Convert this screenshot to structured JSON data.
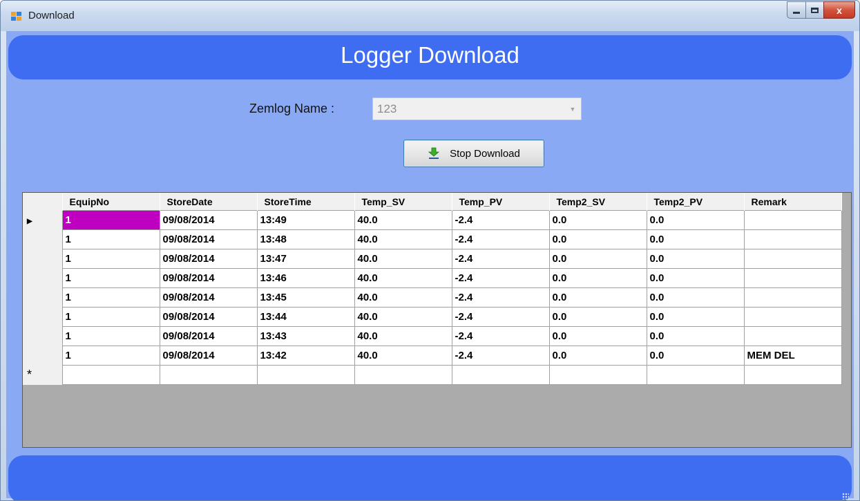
{
  "window": {
    "title": "Download",
    "icon": "windows-form-icon",
    "caption_buttons": [
      "minimize",
      "maximize",
      "close"
    ],
    "close_glyph": "x"
  },
  "header": {
    "title": "Logger Download",
    "banner_color": "#3e6df1"
  },
  "form": {
    "zemlog_label": "Zemlog Name :",
    "zemlog_value": "123",
    "stop_button_label": "Stop Download",
    "stop_button_icon": "download-arrow-icon"
  },
  "grid": {
    "columns": [
      "EquipNo",
      "StoreDate",
      "StoreTime",
      "Temp_SV",
      "Temp_PV",
      "Temp2_SV",
      "Temp2_PV",
      "Remark"
    ],
    "rows": [
      [
        "1",
        "09/08/2014",
        "13:49",
        "40.0",
        "-2.4",
        "0.0",
        "0.0",
        ""
      ],
      [
        "1",
        "09/08/2014",
        "13:48",
        "40.0",
        "-2.4",
        "0.0",
        "0.0",
        ""
      ],
      [
        "1",
        "09/08/2014",
        "13:47",
        "40.0",
        "-2.4",
        "0.0",
        "0.0",
        ""
      ],
      [
        "1",
        "09/08/2014",
        "13:46",
        "40.0",
        "-2.4",
        "0.0",
        "0.0",
        ""
      ],
      [
        "1",
        "09/08/2014",
        "13:45",
        "40.0",
        "-2.4",
        "0.0",
        "0.0",
        ""
      ],
      [
        "1",
        "09/08/2014",
        "13:44",
        "40.0",
        "-2.4",
        "0.0",
        "0.0",
        ""
      ],
      [
        "1",
        "09/08/2014",
        "13:43",
        "40.0",
        "-2.4",
        "0.0",
        "0.0",
        ""
      ],
      [
        "1",
        "09/08/2014",
        "13:42",
        "40.0",
        "-2.4",
        "0.0",
        "0.0",
        "MEM DEL"
      ]
    ],
    "current_row_marker": "▶",
    "new_row_marker": "*",
    "selected_cell_color": "#c000c0"
  },
  "colors": {
    "client_background": "#89a9f5",
    "banner": "#3e6df1"
  }
}
